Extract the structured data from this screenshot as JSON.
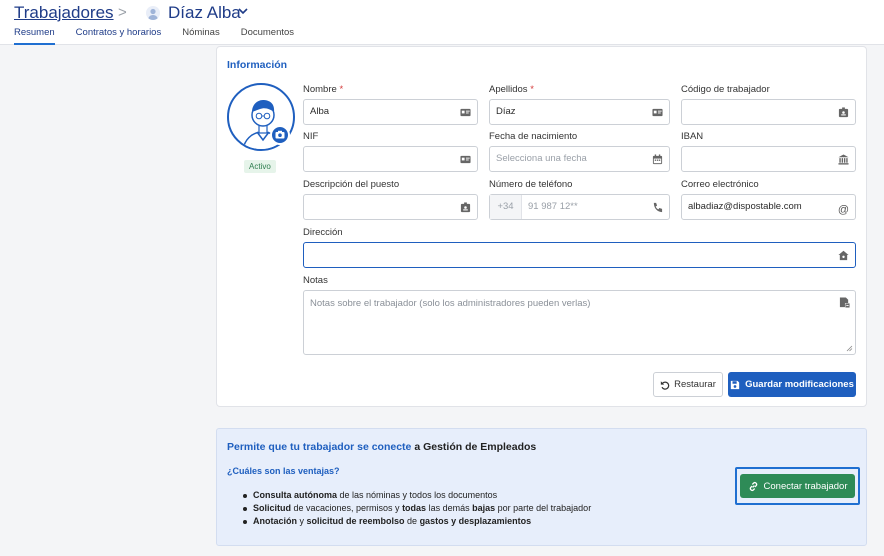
{
  "breadcrumb": {
    "root": "Trabajadores",
    "separator": ">",
    "current": "Díaz Alba"
  },
  "tabs": [
    {
      "label": "Resumen",
      "active": true
    },
    {
      "label": "Contratos y horarios",
      "active": false
    },
    {
      "label": "Nóminas",
      "active": false
    },
    {
      "label": "Documentos",
      "active": false
    }
  ],
  "info": {
    "title": "Información",
    "status": "Activo",
    "fields": {
      "nombre": {
        "label": "Nombre",
        "required": "*",
        "value": "Alba"
      },
      "apellidos": {
        "label": "Apellidos",
        "required": "*",
        "value": "Díaz"
      },
      "codigo": {
        "label": "Código de trabajador",
        "value": ""
      },
      "nif": {
        "label": "NIF",
        "value": ""
      },
      "fecha": {
        "label": "Fecha de nacimiento",
        "placeholder": "Selecciona una fecha"
      },
      "iban": {
        "label": "IBAN",
        "value": ""
      },
      "puesto": {
        "label": "Descripción del puesto",
        "value": ""
      },
      "telefono": {
        "label": "Número de teléfono",
        "prefix": "+34",
        "placeholder": "91 987 12**"
      },
      "correo": {
        "label": "Correo electrónico",
        "value": "albadiaz@dispostable.com"
      },
      "direccion": {
        "label": "Dirección",
        "value": ""
      },
      "notas": {
        "label": "Notas",
        "placeholder": "Notas sobre el trabajador (solo los administradores pueden verlas)"
      }
    },
    "buttons": {
      "reset": "Restaurar",
      "save": "Guardar modificaciones"
    }
  },
  "promo": {
    "title_highlight": "Permite que tu trabajador se conecte",
    "title_rest": " a Gestión de Empleados",
    "question": "¿Cuáles son las ventajas?",
    "items": [
      {
        "b1": "Consulta autónoma",
        "t1": " de las nóminas y todos los documentos",
        "b2": "",
        "t2": "",
        "b3": "",
        "t3": ""
      },
      {
        "b1": "Solicitud",
        "t1": " de vacaciones, permisos y ",
        "b2": "todas",
        "t2": " las demás ",
        "b3": "bajas",
        "t3": " por parte del trabajador"
      },
      {
        "b1": "Anotación",
        "t1": " y ",
        "b2": "solicitud de reembolso",
        "t2": " de ",
        "b3": "gastos y desplazamientos",
        "t3": ""
      }
    ],
    "connect_button": "Conectar trabajador"
  },
  "colors": {
    "primary": "#1f5fbf",
    "success": "#2e8b57",
    "required": "#d43b3b"
  }
}
